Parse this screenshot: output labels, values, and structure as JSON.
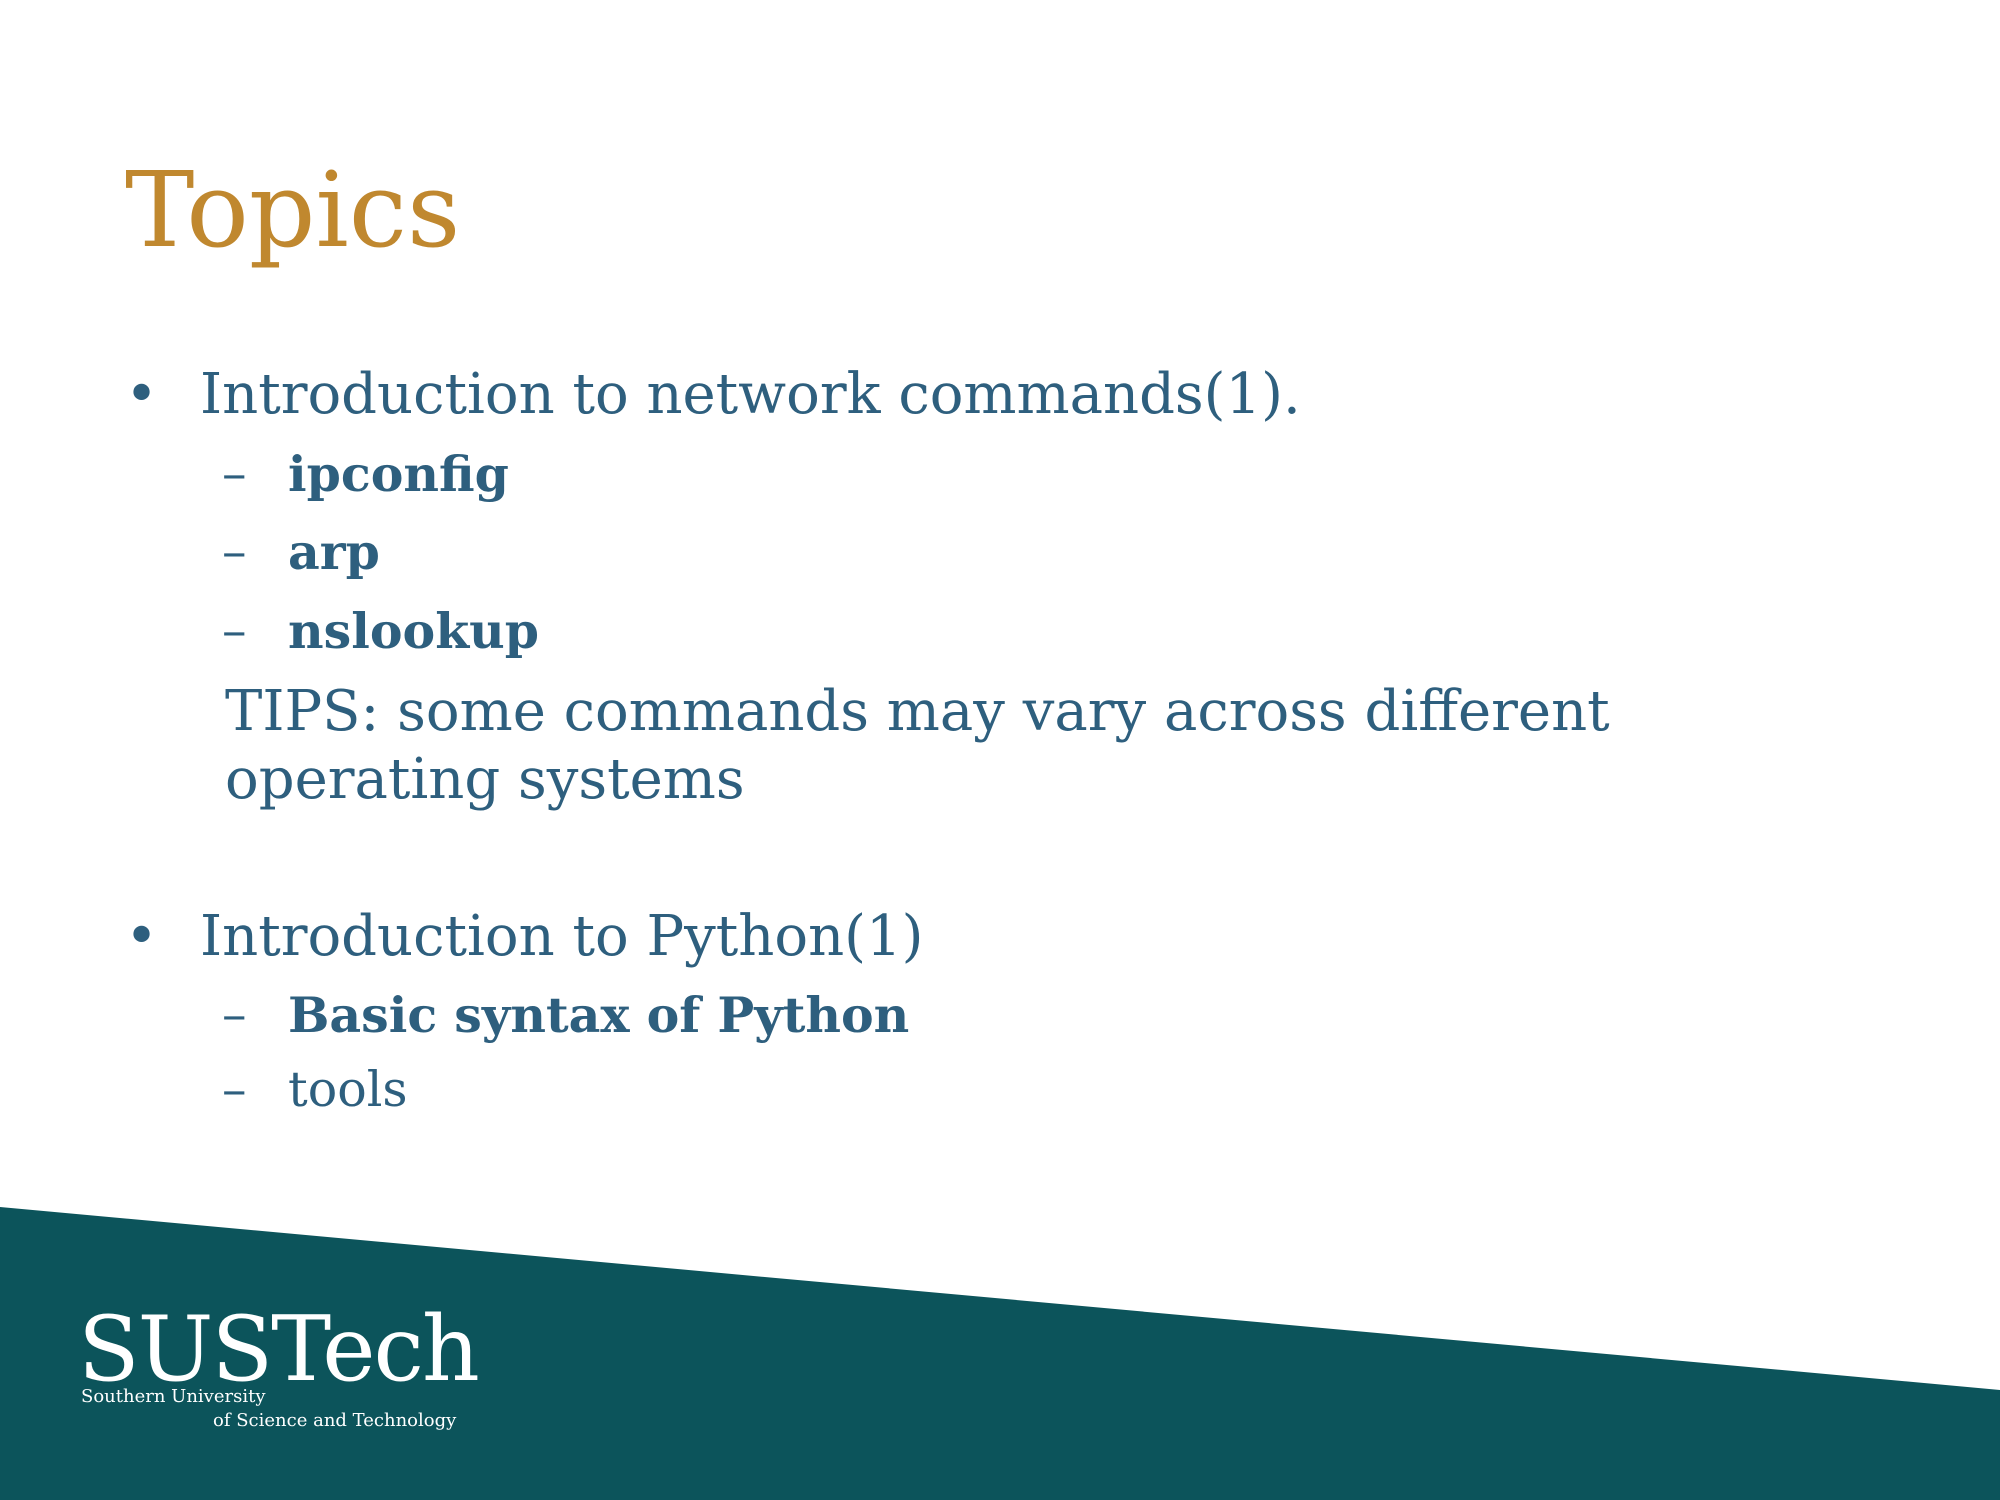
{
  "colors": {
    "title": "#c0882f",
    "body_text": "#2e5f7e",
    "footer_band": "#0c545b",
    "logo_text": "#ffffff",
    "background": "#ffffff"
  },
  "slide": {
    "title": "Topics",
    "sections": [
      {
        "bullet": "•",
        "text": "Introduction to network commands(1).",
        "subitems": [
          {
            "dash": "–",
            "text": "ipconfig",
            "bold": true
          },
          {
            "dash": "–",
            "text": "arp",
            "bold": true
          },
          {
            "dash": "–",
            "text": "nslookup",
            "bold": true
          }
        ],
        "note": "TIPS:  some commands may vary across different operating systems"
      },
      {
        "bullet": "•",
        "text": "Introduction to Python(1)",
        "subitems": [
          {
            "dash": "–",
            "text": "Basic syntax of Python",
            "bold": true
          },
          {
            "dash": "–",
            "text": "tools",
            "bold": false
          }
        ]
      }
    ]
  },
  "logo": {
    "name": "SUSTech",
    "line1": "Southern University",
    "line2": "of Science and Technology"
  }
}
